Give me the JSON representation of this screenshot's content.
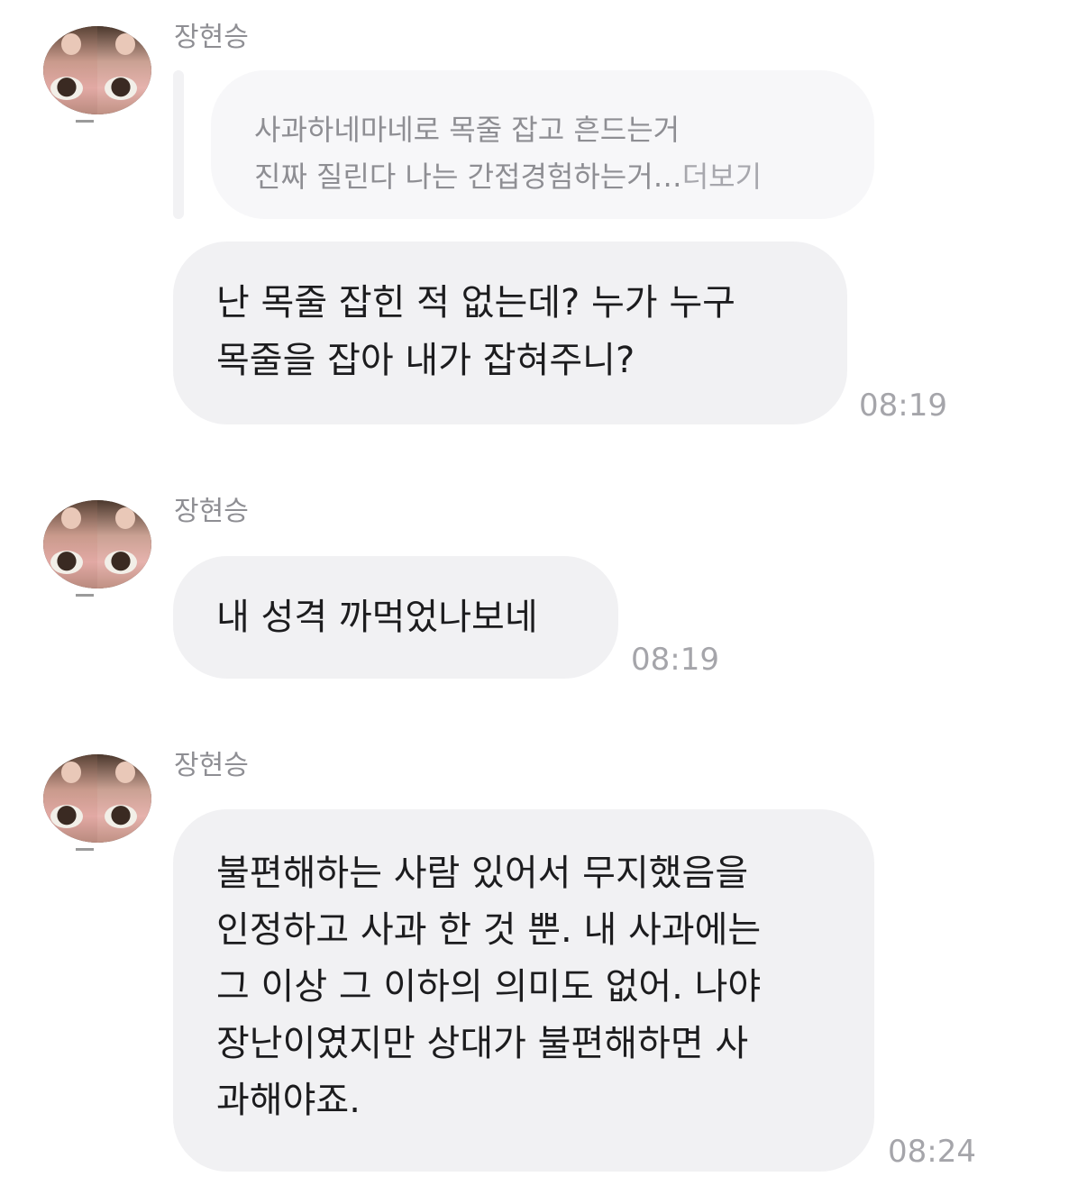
{
  "messages": [
    {
      "sender": "장현승",
      "quote": {
        "line1": "사과하네마네로 목줄 잡고 흔드는거",
        "line2": "진짜 질린다 나는 간접경험하는거…",
        "more_label": "더보기"
      },
      "text": "난 목줄 잡힌 적 없는데? 누가 누구\n목줄을 잡아 내가 잡혀주니?",
      "time": "08:19"
    },
    {
      "sender": "장현승",
      "text": "내 성격 까먹었나보네",
      "time": "08:19"
    },
    {
      "sender": "장현승",
      "text": "불편해하는 사람 있어서 무지했음을\n인정하고 사과 한 것 뿐. 내 사과에는\n그 이상 그 이하의 의미도 없어. 나야\n장난이였지만 상대가 불편해하면 사\n과해야죠.",
      "time": "08:24"
    }
  ]
}
